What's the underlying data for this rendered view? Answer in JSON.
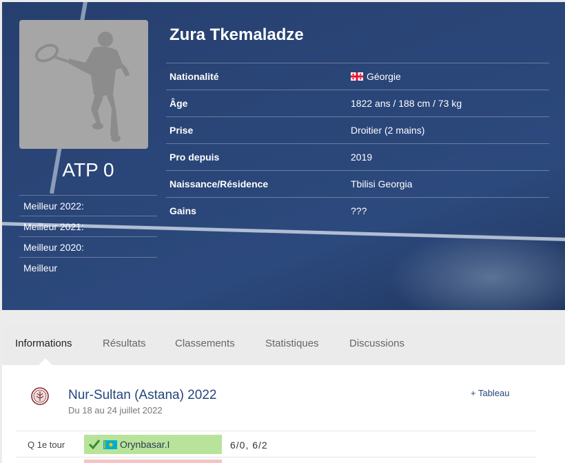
{
  "player": {
    "name": "Zura Tkemaladze",
    "atp_rank": "ATP 0",
    "best": [
      "Meilleur 2022:",
      "Meilleur 2021:",
      "Meilleur 2020:",
      "Meilleur"
    ]
  },
  "info": [
    {
      "label": "Nationalité",
      "value": "Géorgie",
      "flag": "georgia-flag"
    },
    {
      "label": "Âge",
      "value": "1822 ans / 188 cm / 73 kg"
    },
    {
      "label": "Prise",
      "value": "Droitier (2 mains)"
    },
    {
      "label": "Pro depuis",
      "value": "2019"
    },
    {
      "label": "Naissance/Résidence",
      "value": "Tbilisi Georgia"
    },
    {
      "label": "Gains",
      "value": "???"
    }
  ],
  "tabs": [
    "Informations",
    "Résultats",
    "Classements",
    "Statistiques",
    "Discussions"
  ],
  "active_tab": "Informations",
  "tournament": {
    "name": "Nur-Sultan (Astana) 2022",
    "dates": "Du 18 au 24 juillet 2022",
    "tableau_link": "+ Tableau",
    "icon": "tournament-emblem-icon"
  },
  "match": {
    "round": "Q 1e tour",
    "opponent": "Orynbasar.I",
    "opponent_flag": "kazakhstan-flag",
    "result_icon": "check-icon",
    "score": "6/0, 6/2"
  },
  "colors": {
    "hero_bg": "#2a4577",
    "link": "#24457c",
    "win": "#b8e39a",
    "loss": "#f4c4c4"
  }
}
